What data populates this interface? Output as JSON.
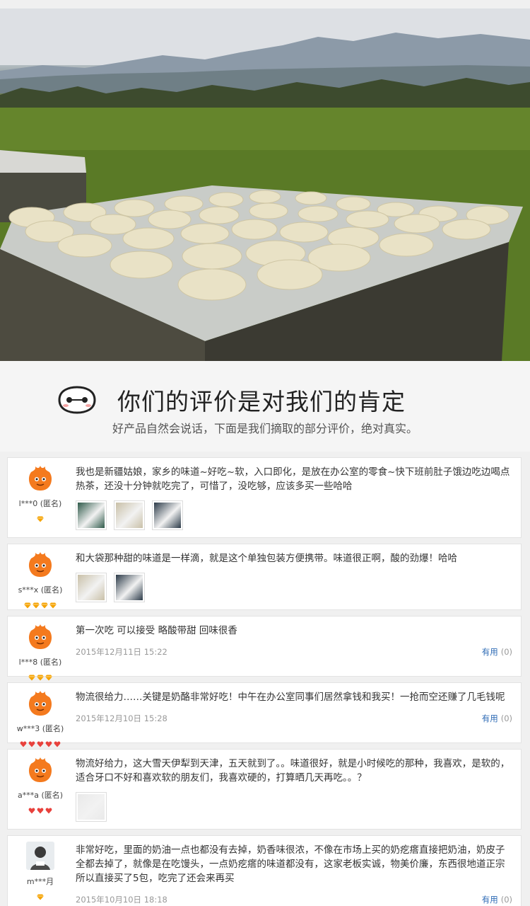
{
  "heading": {
    "title": "你们的评价是对我们的肯定",
    "subtitle": "好产品自然会说话，下面是我们摘取的部分评价，绝对真实。"
  },
  "reviews": [
    {
      "user": "l***0 (匿名)",
      "level": {
        "type": "diamond",
        "count": 1,
        "color": "#f5a300"
      },
      "text": "我也是新疆姑娘，家乡的味道~好吃~软，入口即化，是放在办公室的零食~快下班前肚子饿边吃边喝点热茶，还没十分钟就吃完了，可惜了，没吃够，应该多买一些哈哈",
      "photos": 3,
      "date": "",
      "useful_label": "",
      "useful_count": ""
    },
    {
      "user": "s***x (匿名)",
      "level": {
        "type": "diamond",
        "count": 4,
        "color": "#f5a300"
      },
      "text": "和大袋那种甜的味道是一样滴，就是这个单独包装方便携带。味道很正啊，酸的劲爆！哈哈",
      "photos": 2,
      "date": "",
      "useful_label": "",
      "useful_count": ""
    },
    {
      "user": "l***8 (匿名)",
      "level": {
        "type": "diamond",
        "count": 3,
        "color": "#f5a300"
      },
      "text": "第一次吃 可以接受 略酸带甜 回味很香",
      "photos": 0,
      "date": "2015年12月11日 15:22",
      "useful_label": "有用",
      "useful_count": "(0)"
    },
    {
      "user": "w***3 (匿名)",
      "level": {
        "type": "heart",
        "count": 5,
        "color": "#e8413c"
      },
      "text": "物流很给力……关键是奶酪非常好吃！中午在办公室同事们居然拿钱和我买！一抢而空还赚了几毛钱呢",
      "photos": 0,
      "date": "2015年12月10日 15:28",
      "useful_label": "有用",
      "useful_count": "(0)"
    },
    {
      "user": "a***a (匿名)",
      "level": {
        "type": "heart",
        "count": 3,
        "color": "#e8413c"
      },
      "text": "物流好给力，这大雪天伊犁到天津，五天就到了。。味道很好，就是小时候吃的那种，我喜欢，是软的，适合牙口不好和喜欢软的朋友们，我喜欢硬的，打算晒几天再吃。。？",
      "photos": 1,
      "date": "",
      "useful_label": "",
      "useful_count": ""
    },
    {
      "user": "m***月",
      "level": {
        "type": "diamond",
        "count": 1,
        "color": "#f5a300"
      },
      "text": "非常好吃，里面的奶油一点也都没有去掉，奶香味很浓，不像在市场上买的奶疙瘩直接把奶油，奶皮子全都去掉了，就像是在吃馒头，一点奶疙瘩的味道都没有，这家老板实诚，物美价廉，东西很地道正宗所以直接买了5包，吃完了还会来再买",
      "photos": 0,
      "date": "2015年10月10日 18:18",
      "useful_label": "有用",
      "useful_count": "(0)"
    }
  ]
}
